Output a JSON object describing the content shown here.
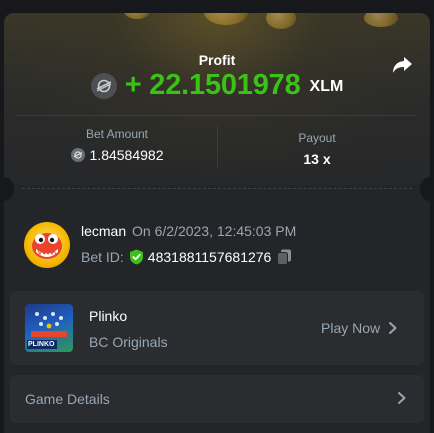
{
  "profit": {
    "label": "Profit",
    "sign": "+",
    "value": "22.1501978",
    "display": "+ 22.1501978",
    "currency": "XLM"
  },
  "bet_amount": {
    "label": "Bet Amount",
    "value": "1.84584982"
  },
  "payout": {
    "label": "Payout",
    "value": "13 x"
  },
  "player": {
    "name": "lecman",
    "date_text": "On 6/2/2023, 12:45:03 PM",
    "bet_id_label": "Bet ID:",
    "bet_id": "4831881157681276"
  },
  "game": {
    "name": "Plinko",
    "provider": "BC Originals",
    "play_label": "Play Now",
    "thumb_text": "PLINKO"
  },
  "details": {
    "label": "Game Details"
  },
  "icons": {
    "currency": "stellar-xlm-icon",
    "share": "share-icon",
    "verified": "shield-check-icon",
    "copy": "copy-icon",
    "chevron": "chevron-right-icon"
  },
  "colors": {
    "profit_green": "#3bc117",
    "muted_text": "#98a7b5",
    "card_bg": "#232528",
    "panel_bg": "#2a2c30"
  }
}
